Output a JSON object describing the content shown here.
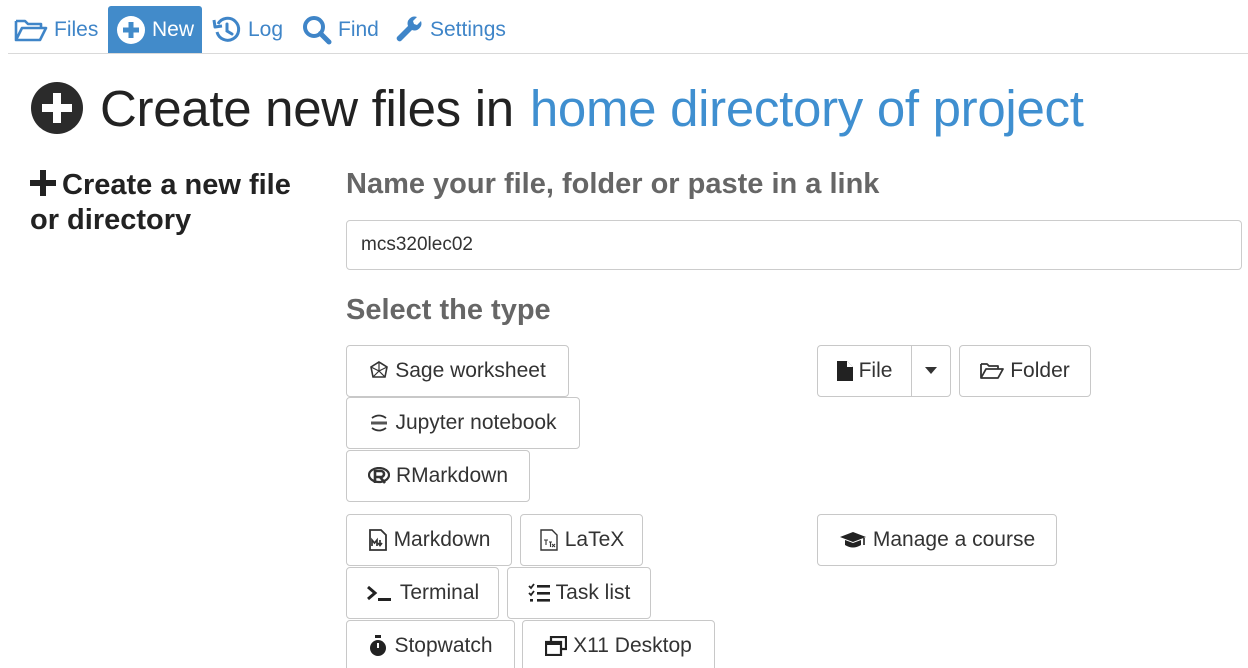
{
  "nav": {
    "files": "Files",
    "new": "New",
    "log": "Log",
    "find": "Find",
    "settings": "Settings",
    "active_tab": "new"
  },
  "heading": {
    "prefix": "Create new files in",
    "highlight": "home directory of project",
    "icon": "plus-circle-icon"
  },
  "sidebar": {
    "title": "Create a new file or directory"
  },
  "name_section": {
    "label": "Name your file, folder or paste in a link",
    "input_value": "mcs320lec02"
  },
  "type_section": {
    "label": "Select the type",
    "buttons": {
      "sage": "Sage worksheet",
      "jupyter": "Jupyter notebook",
      "rmarkdown": "RMarkdown",
      "markdown": "Markdown",
      "latex": "LaTeX",
      "terminal": "Terminal",
      "tasklist": "Task list",
      "stopwatch": "Stopwatch",
      "x11": "X11 Desktop",
      "file": "File",
      "folder": "Folder",
      "course": "Manage a course"
    }
  },
  "colors": {
    "accent": "#428bca",
    "link": "#3f85c8",
    "heading_highlight": "#3f8fd0",
    "section_label": "#666666"
  }
}
